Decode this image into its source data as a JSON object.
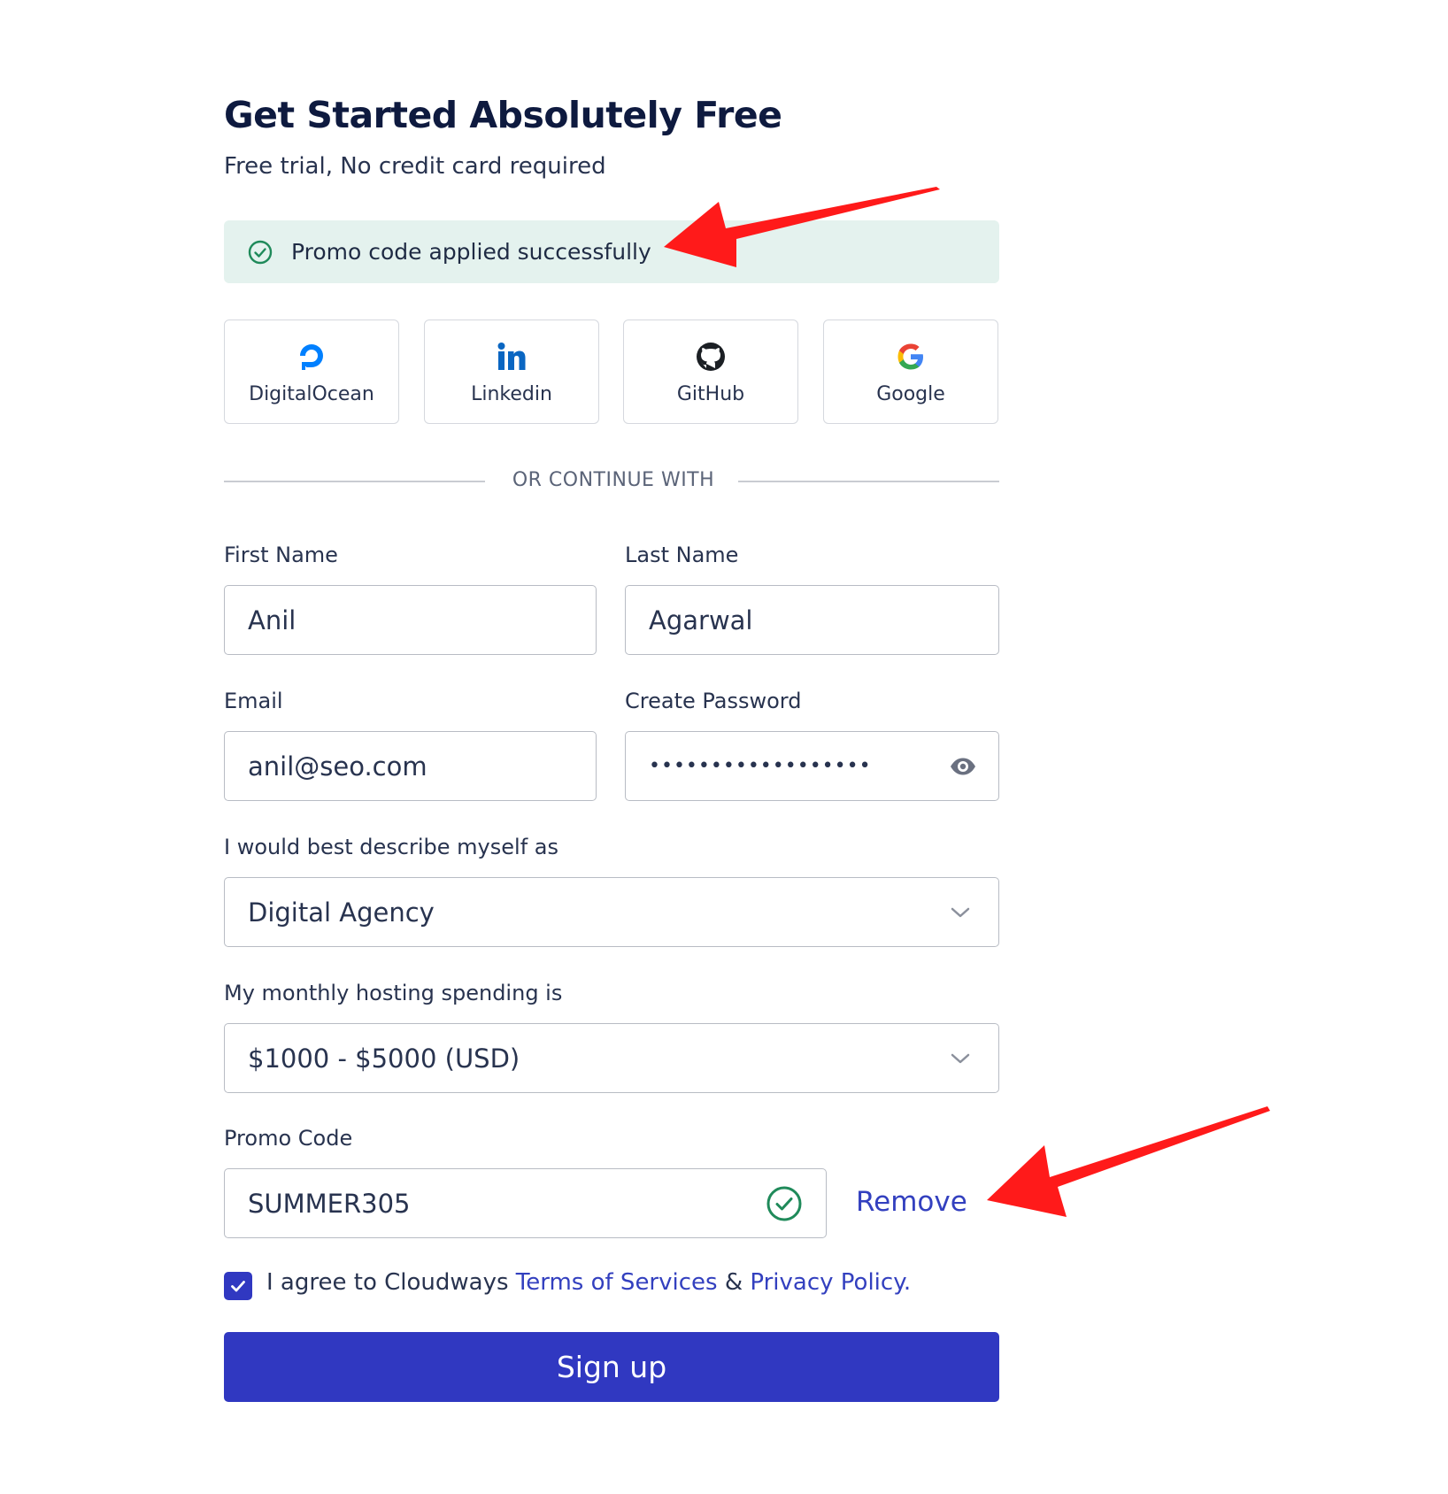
{
  "header": {
    "title": "Get Started Absolutely Free",
    "subtitle": "Free trial, No credit card required"
  },
  "alert": {
    "message": "Promo code applied successfully",
    "icon": "check-circle-icon",
    "color": "#1f8a5a"
  },
  "social": [
    {
      "label": "DigitalOcean",
      "icon": "digitalocean-icon"
    },
    {
      "label": "Linkedin",
      "icon": "linkedin-icon"
    },
    {
      "label": "GitHub",
      "icon": "github-icon"
    },
    {
      "label": "Google",
      "icon": "google-icon"
    }
  ],
  "divider": {
    "text": "OR CONTINUE WITH"
  },
  "form": {
    "first_name": {
      "label": "First Name",
      "value": "Anil"
    },
    "last_name": {
      "label": "Last Name",
      "value": "Agarwal"
    },
    "email": {
      "label": "Email",
      "value": "anil@seo.com"
    },
    "password": {
      "label": "Create Password",
      "value": "••••••••••••••••••"
    },
    "describe": {
      "label": "I would best describe myself as",
      "value": "Digital Agency"
    },
    "spending": {
      "label": "My monthly hosting spending is",
      "value": "$1000 - $5000 (USD)"
    },
    "promo": {
      "label": "Promo Code",
      "value": "SUMMER305",
      "remove_label": "Remove"
    }
  },
  "agree": {
    "prefix": "I agree to Cloudways",
    "terms": "Terms of Services",
    "amp": "&",
    "privacy": "Privacy Policy."
  },
  "signup_label": "Sign up",
  "colors": {
    "primary": "#3038c1",
    "link": "#3340bf",
    "success": "#1f8a5a",
    "annotation_arrow": "#ff1a1a"
  }
}
